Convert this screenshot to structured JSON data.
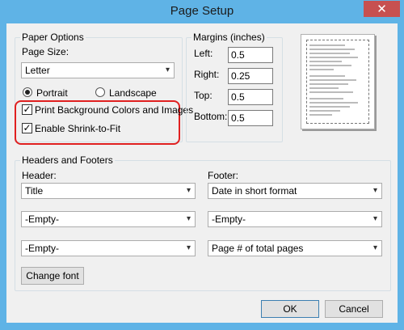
{
  "window": {
    "title": "Page Setup",
    "close_glyph": "✕"
  },
  "paper_options": {
    "legend": "Paper Options",
    "page_size_label": "Page Size:",
    "page_size_value": "Letter",
    "portrait_label": "Portrait",
    "landscape_label": "Landscape",
    "orientation_selected": "Portrait",
    "print_background_label": "Print Background Colors and Images",
    "print_background_checked": true,
    "shrink_to_fit_label": "Enable Shrink-to-Fit",
    "shrink_to_fit_checked": true,
    "check_glyph": "✓"
  },
  "margins": {
    "legend": "Margins (inches)",
    "left_label": "Left:",
    "left_value": "0.5",
    "right_label": "Right:",
    "right_value": "0.25",
    "top_label": "Top:",
    "top_value": "0.5",
    "bottom_label": "Bottom:",
    "bottom_value": "0.5"
  },
  "headers_footers": {
    "legend": "Headers and Footers",
    "header_label": "Header:",
    "footer_label": "Footer:",
    "header_values": [
      "Title",
      "-Empty-",
      "-Empty-"
    ],
    "footer_values": [
      "Date in short format",
      "-Empty-",
      "Page # of total pages"
    ],
    "change_font_label": "Change font"
  },
  "buttons": {
    "ok": "OK",
    "cancel": "Cancel"
  },
  "icons": {
    "dropdown_arrow": "▾"
  },
  "colors": {
    "titlebar": "#5fb3e6",
    "close": "#c75050",
    "highlight": "#e02020"
  }
}
